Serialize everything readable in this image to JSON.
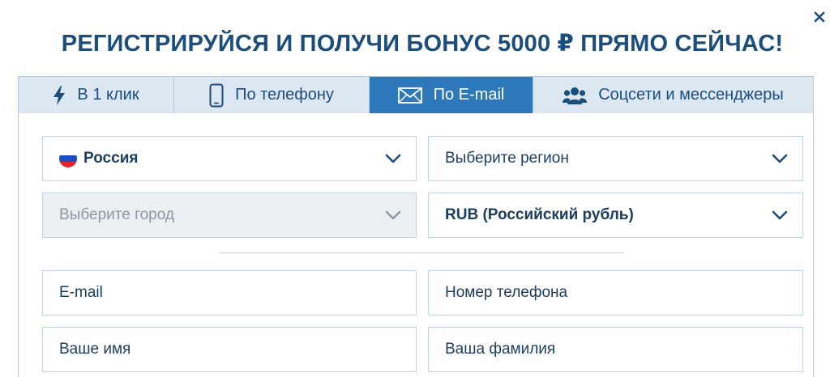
{
  "title": "РЕГИСТРИРУЙСЯ И ПОЛУЧИ БОНУС 5000 ₽ ПРЯМО СЕЙЧАС!",
  "tabs": [
    {
      "label": "В 1 клик",
      "icon": "lightning-icon",
      "active": false
    },
    {
      "label": "По телефону",
      "icon": "phone-icon",
      "active": false
    },
    {
      "label": "По E-mail",
      "icon": "envelope-icon",
      "active": true
    },
    {
      "label": "Соцсети и мессенджеры",
      "icon": "users-icon",
      "active": false
    }
  ],
  "form": {
    "country": {
      "value": "Россия",
      "icon": "russia-flag-icon"
    },
    "region": {
      "placeholder": "Выберите регион"
    },
    "city": {
      "placeholder": "Выберите город",
      "disabled": true
    },
    "currency": {
      "value": "RUB (Российский рубль)"
    },
    "email": {
      "placeholder": "E-mail"
    },
    "phone": {
      "placeholder": "Номер телефона"
    },
    "first_name": {
      "placeholder": "Ваше имя"
    },
    "last_name": {
      "placeholder": "Ваша фамилия"
    }
  },
  "colors": {
    "title": "#1b4d7d",
    "tab_bg": "#dde7f1",
    "tab_active_bg": "#2d78bb",
    "border": "#c4d2df",
    "disabled_bg": "#eceff2"
  }
}
